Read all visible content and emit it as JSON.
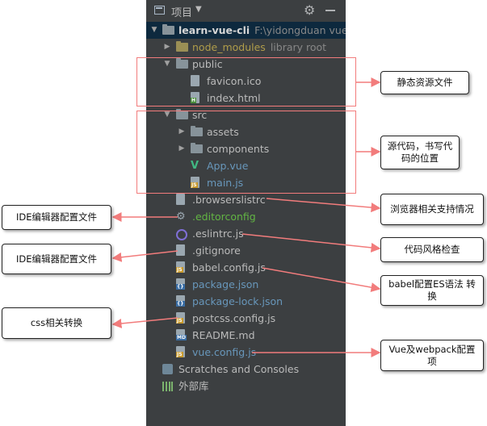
{
  "panel": {
    "title": "项目",
    "icons": {
      "header": "project-icon",
      "caret": "chevron-down-icon",
      "settings": "gear-icon",
      "minimize": "minimize-icon"
    }
  },
  "tree": [
    {
      "name": "learn-vue-cli",
      "extra": "F:\\yidongduan vue\\V",
      "icon": "folder",
      "arrow": "expanded",
      "style": "bold"
    },
    {
      "name": "node_modules",
      "extra": "library root",
      "icon": "folder-gold",
      "arrow": "collapsed",
      "style": "module"
    },
    {
      "name": "public",
      "icon": "folder",
      "arrow": "expanded",
      "style": "default"
    },
    {
      "name": "favicon.ico",
      "icon": "file",
      "style": "default"
    },
    {
      "name": "index.html",
      "icon": "file-html",
      "style": "default"
    },
    {
      "name": "src",
      "icon": "folder",
      "arrow": "expanded",
      "style": "default"
    },
    {
      "name": "assets",
      "icon": "folder",
      "arrow": "collapsed",
      "style": "default"
    },
    {
      "name": "components",
      "icon": "folder",
      "arrow": "collapsed",
      "style": "default"
    },
    {
      "name": "App.vue",
      "icon": "vue",
      "style": "blue"
    },
    {
      "name": "main.js",
      "icon": "file-js",
      "style": "blue"
    },
    {
      "name": ".browserslistrc",
      "icon": "file",
      "style": "default"
    },
    {
      "name": ".editorconfig",
      "icon": "gear",
      "style": "green"
    },
    {
      "name": ".eslintrc.js",
      "icon": "eslint",
      "style": "default"
    },
    {
      "name": ".gitignore",
      "icon": "file",
      "style": "default"
    },
    {
      "name": "babel.config.js",
      "icon": "file-js",
      "style": "default"
    },
    {
      "name": "package.json",
      "icon": "file-json",
      "style": "blue"
    },
    {
      "name": "package-lock.json",
      "icon": "file-json",
      "style": "blue"
    },
    {
      "name": "postcss.config.js",
      "icon": "file-js",
      "style": "default"
    },
    {
      "name": "README.md",
      "icon": "file-md",
      "style": "default"
    },
    {
      "name": "vue.config.js",
      "icon": "file-js",
      "style": "blue"
    },
    {
      "name": "Scratches and Consoles",
      "icon": "scratch",
      "style": "default"
    },
    {
      "name": "外部库",
      "icon": "library",
      "style": "default"
    }
  ],
  "annotations": {
    "public": "静态资源文件",
    "src": "源代码，书写代码的位置",
    "browserslist": "浏览器相关支持情况",
    "editorconfig": "IDE编辑器配置文件",
    "eslint": "代码风格检查",
    "gitignore": "IDE编辑器配置文件",
    "babel": "babel配置ES语法 转换",
    "postcss": "css相关转换",
    "vueconfig": "Vue及webpack配置项"
  },
  "colors": {
    "panel_bg": "#3c3f41",
    "annotation_line": "#f27c7c",
    "vue_green": "#41b883",
    "module_gold": "#b09d4a"
  }
}
